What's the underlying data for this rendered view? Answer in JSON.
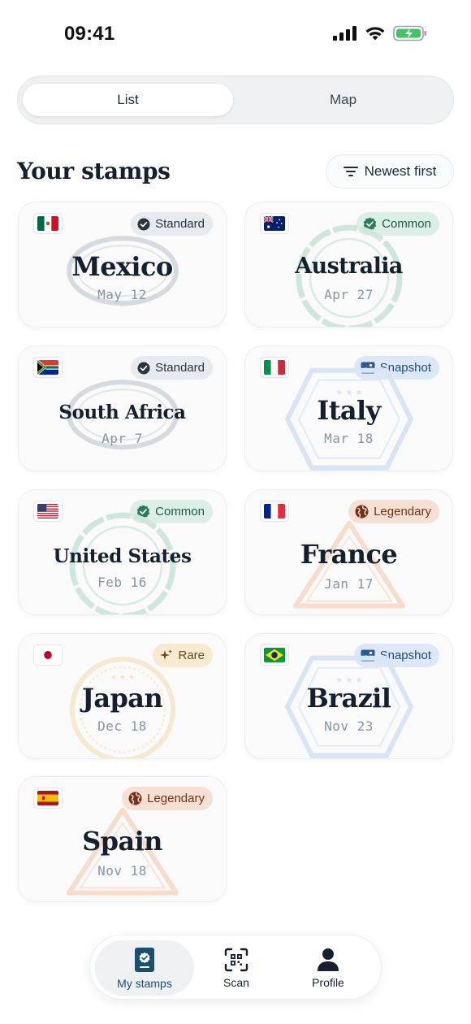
{
  "status_bar": {
    "time": "09:41"
  },
  "view_toggle": {
    "list_label": "List",
    "map_label": "Map",
    "selected": "List"
  },
  "section": {
    "title": "Your stamps",
    "sort_label": "Newest first"
  },
  "stamps": [
    {
      "country": "Mexico",
      "date": "May 12",
      "badge": "Standard",
      "flag": "mexico-flag-icon",
      "icon": "check-circle-icon"
    },
    {
      "country": "Australia",
      "date": "Apr 27",
      "badge": "Common",
      "flag": "australia-flag-icon",
      "icon": "verified-badge-icon"
    },
    {
      "country": "South Africa",
      "date": "Apr 7",
      "badge": "Standard",
      "flag": "south-africa-flag-icon",
      "icon": "check-circle-icon"
    },
    {
      "country": "Italy",
      "date": "Mar 18",
      "badge": "Snapshot",
      "flag": "italy-flag-icon",
      "icon": "image-icon"
    },
    {
      "country": "United States",
      "date": "Feb 16",
      "badge": "Common",
      "flag": "us-flag-icon",
      "icon": "verified-badge-icon"
    },
    {
      "country": "France",
      "date": "Jan 17",
      "badge": "Legendary",
      "flag": "france-flag-icon",
      "icon": "globe-icon"
    },
    {
      "country": "Japan",
      "date": "Dec 18",
      "badge": "Rare",
      "flag": "japan-flag-icon",
      "icon": "sparkle-icon"
    },
    {
      "country": "Brazil",
      "date": "Nov 23",
      "badge": "Snapshot",
      "flag": "brazil-flag-icon",
      "icon": "image-icon"
    },
    {
      "country": "Spain",
      "date": "Nov 18",
      "badge": "Legendary",
      "flag": "spain-flag-icon",
      "icon": "globe-icon"
    }
  ],
  "bottom_nav": {
    "my_stamps_label": "My stamps",
    "scan_label": "Scan",
    "profile_label": "Profile",
    "active": "My stamps"
  },
  "colors": {
    "accent": "#1b4f6e",
    "standard": "#e7eaee",
    "common": "#dcefe6",
    "snapshot": "#dce8f7",
    "legendary": "#f6dfd3",
    "rare": "#f6ead0"
  }
}
